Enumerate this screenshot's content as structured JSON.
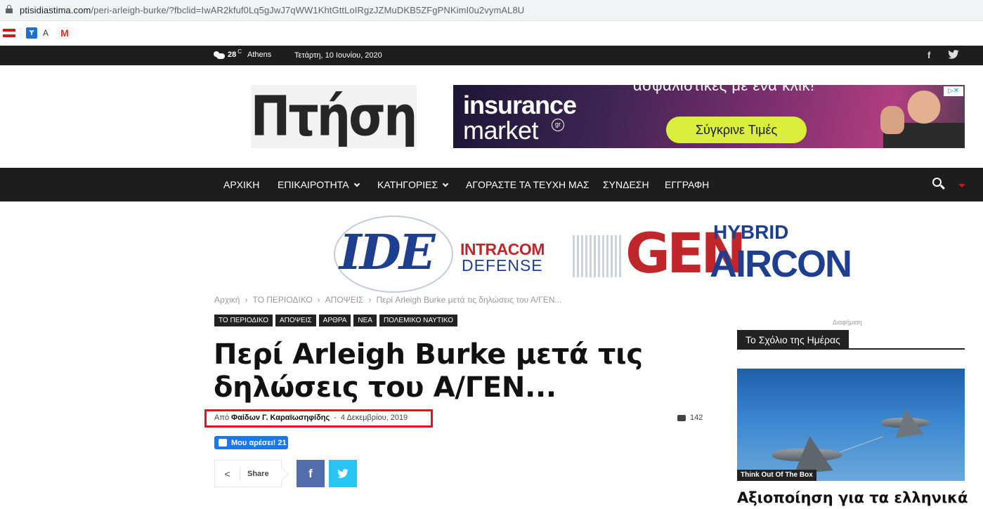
{
  "browser": {
    "url_host": "ptisidiastima.com",
    "url_path": "/peri-arleigh-burke/?fbclid=IwAR2kfuf0Lq5gJwJ7qWW1KhtGttLoIRgzJZMuDKB5ZFgPNKimI0u2vymAL8U"
  },
  "bookmarks": [
    {
      "icon": "flag-icon",
      "label": ""
    },
    {
      "icon": "translate-icon",
      "label": "A"
    },
    {
      "icon": "gmail-icon",
      "label": ""
    }
  ],
  "topbar": {
    "temperature": "28",
    "unit": "C",
    "city": "Athens",
    "date": "Τετάρτη, 10 Ιουνίου, 2020",
    "social": [
      "facebook-icon",
      "twitter-icon"
    ]
  },
  "header": {
    "logo_text": "Πτήση",
    "ad": {
      "brand_line1": "insurance",
      "brand_line2": "market",
      "brand_tld": "gr",
      "headline": "ασφαλιστικές με ένα κλικ!",
      "cta": "Σύγκρινε Τιμές"
    }
  },
  "nav": {
    "items": [
      {
        "label": "ΑΡΧΙΚΗ",
        "dropdown": false
      },
      {
        "label": "ΕΠΙΚΑΙΡΟΤΗΤΑ",
        "dropdown": true
      },
      {
        "label": "ΚΑΤΗΓΟΡΙΕΣ",
        "dropdown": true
      },
      {
        "label": "ΑΓΟΡΑΣΤΕ ΤΑ ΤΕΥΧΗ ΜΑΣ",
        "dropdown": false
      },
      {
        "label": "ΣΥΝΔΕΣΗ",
        "dropdown": false
      },
      {
        "label": "ΕΓΓΡΑΦΗ",
        "dropdown": false
      }
    ]
  },
  "banner": {
    "ide": "IDE",
    "intracom": "INTRACOM",
    "defense": "DEFENSE",
    "gen": "GEN",
    "hybrid": "HYBRID",
    "aircon": "AIRCON"
  },
  "breadcrumb": [
    "Αρχική",
    "ΤΟ ΠΕΡΙΟΔΙΚΟ",
    "ΑΠΟΨΕΙΣ",
    "Περί Arleigh Burke μετά τις δηλώσεις του Α/ΓΕΝ..."
  ],
  "article": {
    "tags": [
      "ΤΟ ΠΕΡΙΟΔΙΚΟ",
      "ΑΠΟΨΕΙΣ",
      "ΑΡΘΡΑ",
      "ΝΕΑ",
      "ΠΟΛΕΜΙΚΟ ΝΑΥΤΙΚΟ"
    ],
    "title_line1": "Περί Arleigh Burke μετά τις",
    "title_line2": "δηλώσεις του Α/ΓΕΝ...",
    "by_label": "Από",
    "author": "Φαίδων Γ. Καραϊωσηφίδης",
    "date": "4 Δεκεμβρίου, 2019",
    "comments": "142",
    "fb_like": "Μου αρέσει! 21",
    "share_label": "Share"
  },
  "sidebar": {
    "ad_label": "Διαφήμιση",
    "section_title": "Το Σχόλιο της Ημέρας",
    "category": "Think Out Of The Box",
    "post_title": "Αξιοποίηση για τα ελληνικά"
  }
}
